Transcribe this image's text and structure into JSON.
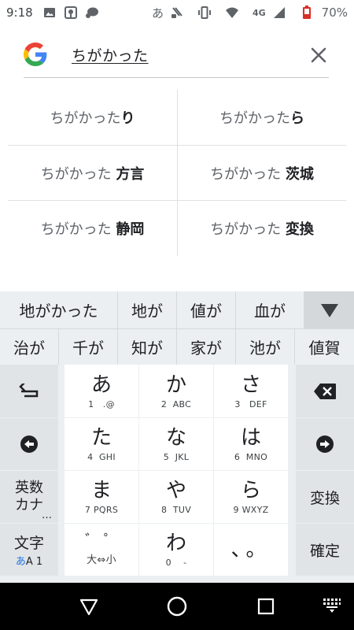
{
  "status_bar": {
    "time": "9:18",
    "ime_indicator": "あ",
    "network": "4G",
    "battery": "70%"
  },
  "search": {
    "query": "ちがかった"
  },
  "suggestions": [
    [
      {
        "prefix": "ちがかった",
        "suffix": "り"
      },
      {
        "prefix": "ちがかった",
        "suffix": "ら"
      }
    ],
    [
      {
        "prefix": "ちがかった ",
        "suffix": "方言"
      },
      {
        "prefix": "ちがかった ",
        "suffix": "茨城"
      }
    ],
    [
      {
        "prefix": "ちがかった ",
        "suffix": "静岡"
      },
      {
        "prefix": "ちがかった ",
        "suffix": "変換"
      }
    ]
  ],
  "candidates": {
    "row1": [
      "地がかった",
      "地が",
      "値が",
      "血が"
    ],
    "row2": [
      "治が",
      "千が",
      "知が",
      "家が",
      "池が",
      "値賀"
    ]
  },
  "keyboard": {
    "left": {
      "undo_icon": "undo-arrow-icon",
      "cursor_left_icon": "arrow-left-icon",
      "eisu_kana": [
        "英数",
        "カナ",
        "…"
      ],
      "moji_label": "文字",
      "moji_sub_kana": "あ",
      "moji_sub_rest": "A 1"
    },
    "keys": [
      {
        "main": "あ",
        "sub": "1   .@"
      },
      {
        "main": "か",
        "sub": "2  ABC"
      },
      {
        "main": "さ",
        "sub": "3   DEF"
      },
      {
        "main": "た",
        "sub": "4  GHI"
      },
      {
        "main": "な",
        "sub": "5  JKL"
      },
      {
        "main": "は",
        "sub": "6  MNO"
      },
      {
        "main": "ま",
        "sub": "7 PQRS"
      },
      {
        "main": "や",
        "sub": "8  TUV"
      },
      {
        "main": "ら",
        "sub": "9 WXYZ"
      },
      {
        "main": "゛ ゜",
        "sub": "大⇔小"
      },
      {
        "main": "わ",
        "sub": "0    -"
      },
      {
        "main": "、。",
        "sub": ""
      }
    ],
    "right": {
      "backspace_icon": "backspace-icon",
      "cursor_right_icon": "arrow-right-icon",
      "convert_label": "変換",
      "confirm_label": "確定"
    }
  },
  "nav_bar": {
    "back_icon": "back-triangle-icon",
    "home_icon": "home-circle-icon",
    "recents_icon": "recents-square-icon",
    "keyboard_icon": "keyboard-switch-icon"
  }
}
